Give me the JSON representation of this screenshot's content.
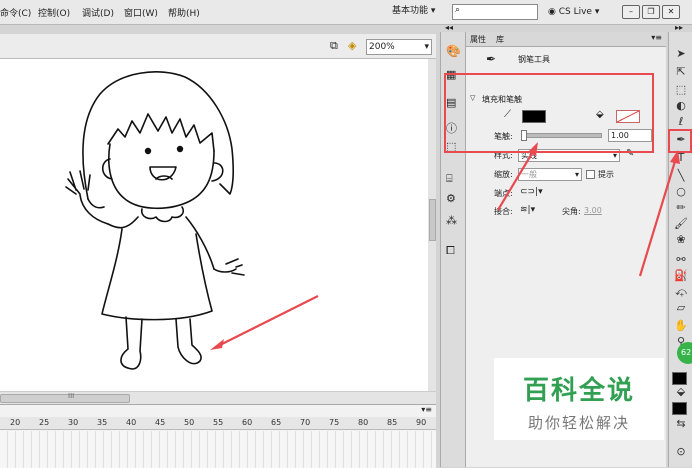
{
  "menu": {
    "items": [
      "命令(C)",
      "控制(O)",
      "调试(D)",
      "窗口(W)",
      "帮助(H)"
    ],
    "workspace_label": "基本功能",
    "cslive_label": "CS Live"
  },
  "stage": {
    "zoom": "200%",
    "hscroll_marker": "III"
  },
  "timeline": {
    "ticks": [
      "20",
      "25",
      "30",
      "35",
      "40",
      "45",
      "50",
      "55",
      "60",
      "65",
      "70",
      "75",
      "80",
      "85",
      "90"
    ]
  },
  "properties": {
    "tab_properties": "属性",
    "tab_library": "库",
    "tool_name": "钢笔工具",
    "section_fill_stroke": "填充和笔触",
    "stroke_label": "笔触:",
    "stroke_value": "1.00",
    "style_label": "样式:",
    "style_value": "实线",
    "scale_label": "缩放:",
    "scale_value": "一般",
    "hint_label": "提示",
    "cap_label": "端点:",
    "join_label": "接合:",
    "miter_label": "尖角:",
    "miter_value": "3.00"
  },
  "watermark": {
    "title": "百科全说",
    "subtitle": "助你轻松解决"
  },
  "badge": {
    "value": "62"
  },
  "colors": {
    "highlight": "#e84a50",
    "watermark_green": "#31a052"
  }
}
